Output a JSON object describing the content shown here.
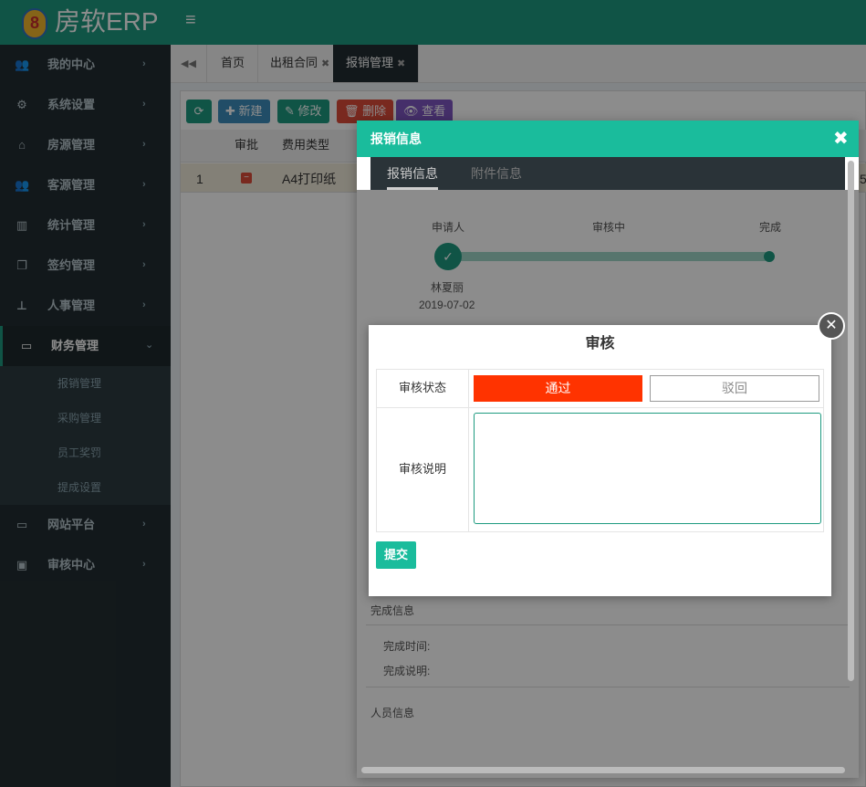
{
  "app": {
    "logo_badge": "8",
    "title": "房软ERP",
    "menu_icon": "menu-icon"
  },
  "sidebar": {
    "items": [
      {
        "label": "我的中心",
        "icon": "users-icon"
      },
      {
        "label": "系统设置",
        "icon": "gears-icon"
      },
      {
        "label": "房源管理",
        "icon": "home-icon"
      },
      {
        "label": "客源管理",
        "icon": "users-icon"
      },
      {
        "label": "统计管理",
        "icon": "bar-chart-icon"
      },
      {
        "label": "签约管理",
        "icon": "files-icon"
      },
      {
        "label": "人事管理",
        "icon": "org-chart-icon"
      },
      {
        "label": "财务管理",
        "icon": "credit-card-icon"
      }
    ],
    "finance_sub": [
      "报销管理",
      "采购管理",
      "员工奖罚",
      "提成设置"
    ],
    "items_after": [
      {
        "label": "网站平台",
        "icon": "desktop-icon"
      },
      {
        "label": "审核中心",
        "icon": "gift-icon"
      }
    ]
  },
  "tabs": [
    {
      "label": "首页"
    },
    {
      "label": "出租合同"
    },
    {
      "label": "报销管理"
    }
  ],
  "toolbar": {
    "refresh": "",
    "new": "新建",
    "edit": "修改",
    "delete": "删除",
    "view": "查看"
  },
  "grid": {
    "headers": [
      "审批",
      "费用类型"
    ],
    "rows": [
      {
        "index": "1",
        "type": "A4打印纸",
        "edge": "5"
      }
    ]
  },
  "modal": {
    "title": "报销信息",
    "tabs": [
      "报销信息",
      "附件信息"
    ],
    "flow": {
      "steps": [
        "申请人",
        "审核中",
        "完成"
      ],
      "applicant": "林夏丽",
      "date": "2019-07-02"
    },
    "complete_section": "完成信息",
    "complete_time_label": "完成时间:",
    "complete_note_label": "完成说明:",
    "people_section": "人员信息"
  },
  "review": {
    "title": "审核",
    "status_label": "审核状态",
    "pass": "通过",
    "reject": "驳回",
    "note_label": "审核说明",
    "note_value": "",
    "submit": "提交"
  },
  "colors": {
    "header": "#1e9a80",
    "sidebar": "#222d32",
    "modal_header": "#1abc9c",
    "pass": "#ff3300"
  }
}
